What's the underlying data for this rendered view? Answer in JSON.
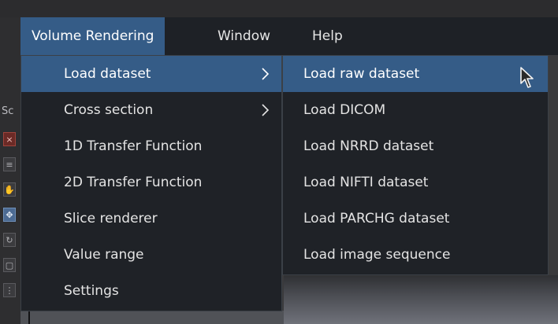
{
  "menubar": {
    "items": [
      {
        "label": "Volume Rendering"
      },
      {
        "label": "Window"
      },
      {
        "label": "Help"
      }
    ]
  },
  "main_menu": {
    "items": [
      {
        "label": "Load dataset",
        "has_submenu": true
      },
      {
        "label": "Cross section",
        "has_submenu": true
      },
      {
        "label": "1D Transfer Function"
      },
      {
        "label": "2D Transfer Function"
      },
      {
        "label": "Slice renderer"
      },
      {
        "label": "Value range"
      },
      {
        "label": "Settings"
      }
    ]
  },
  "submenu": {
    "items": [
      {
        "label": "Load raw dataset"
      },
      {
        "label": "Load DICOM"
      },
      {
        "label": "Load NRRD dataset"
      },
      {
        "label": "Load NIFTI dataset"
      },
      {
        "label": "Load PARCHG dataset"
      },
      {
        "label": "Load image sequence"
      }
    ]
  },
  "background": {
    "left_panel_label": "Sc"
  },
  "colors": {
    "menu_bg": "#1f2227",
    "highlight": "#355c87",
    "text": "#e4e4e4"
  }
}
